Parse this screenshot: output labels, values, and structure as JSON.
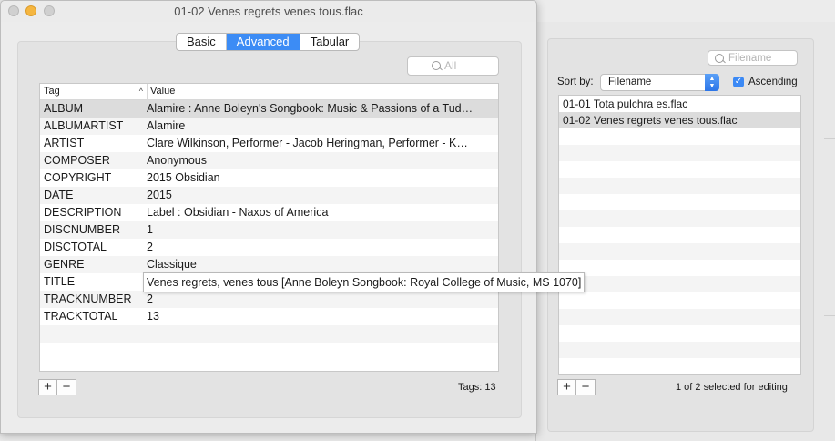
{
  "main_window": {
    "title": "01-02 Venes regrets venes tous.flac",
    "tabs": [
      {
        "label": "Basic",
        "active": false
      },
      {
        "label": "Advanced",
        "active": true
      },
      {
        "label": "Tabular",
        "active": false
      }
    ],
    "search_placeholder": "All",
    "table": {
      "col_tag": "Tag",
      "col_value": "Value",
      "rows": [
        {
          "tag": "ALBUM",
          "value": "Alamire : Anne Boleyn's Songbook: Music & Passions of a Tud…"
        },
        {
          "tag": "ALBUMARTIST",
          "value": "Alamire"
        },
        {
          "tag": "ARTIST",
          "value": "Clare Wilkinson, Performer - Jacob Heringman, Performer - K…"
        },
        {
          "tag": "COMPOSER",
          "value": "Anonymous"
        },
        {
          "tag": "COPYRIGHT",
          "value": "2015 Obsidian"
        },
        {
          "tag": "DATE",
          "value": "2015"
        },
        {
          "tag": "DESCRIPTION",
          "value": "Label : Obsidian - Naxos of America"
        },
        {
          "tag": "DISCNUMBER",
          "value": "1"
        },
        {
          "tag": "DISCTOTAL",
          "value": "2"
        },
        {
          "tag": "GENRE",
          "value": "Classique"
        },
        {
          "tag": "TITLE",
          "value": ""
        },
        {
          "tag": "TRACKNUMBER",
          "value": "2"
        },
        {
          "tag": "TRACKTOTAL",
          "value": "13"
        }
      ]
    },
    "tooltip": "Venes regrets, venes tous [Anne Boleyn Songbook: Royal College of Music, MS 1070]",
    "add_label": "+",
    "remove_label": "−",
    "tags_count": "Tags: 13"
  },
  "side_window": {
    "search_placeholder": "Filename",
    "sort_label": "Sort by:",
    "sort_value": "Filename",
    "ascending_label": "Ascending",
    "ascending_checked": true,
    "files": [
      {
        "name": "01-01 Tota pulchra es.flac",
        "selected": false
      },
      {
        "name": "01-02 Venes regrets venes tous.flac",
        "selected": true
      }
    ],
    "add_label": "+",
    "remove_label": "−",
    "status": "1 of 2 selected for editing"
  },
  "colors": {
    "accent": "#3c8cf5",
    "selection": "#dcdcdc"
  }
}
